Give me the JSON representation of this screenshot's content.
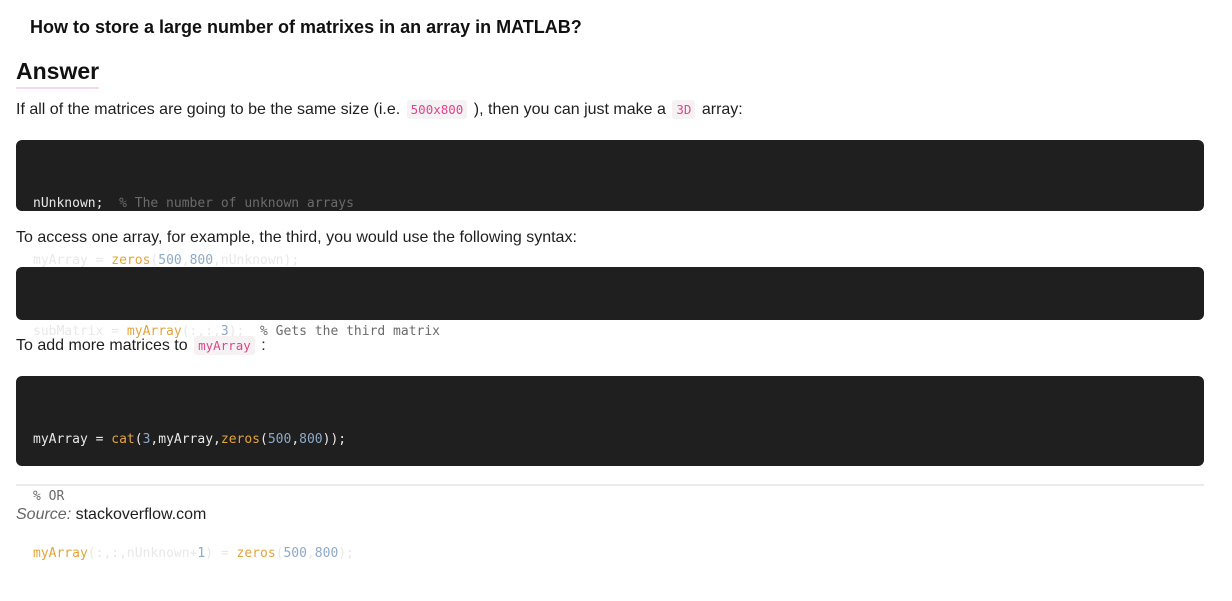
{
  "question": "How to store a large number of matrixes in an array in MATLAB?",
  "answer_heading": "Answer",
  "para1": {
    "t1": "If all of the matrices are going to be the same size (i.e. ",
    "code1": "500x800",
    "t2": " ), then you can just make a ",
    "code2": "3D",
    "t3": " array:"
  },
  "code1": {
    "l1": {
      "a": "nUnknown;  ",
      "b": "% The number of unknown arrays"
    },
    "l2": {
      "a": "myArray = ",
      "f": "zeros",
      "p1": "(",
      "n1": "500",
      "c1": ",",
      "n2": "800",
      "r": ",nUnknown);"
    }
  },
  "para2": "To access one array, for example, the third, you would use the following syntax:",
  "code2": {
    "l1": {
      "a": "subMatrix = ",
      "f": "myArray",
      "p": "(:,:,",
      "n": "3",
      "r": ");  ",
      "c": "% Gets the third matrix"
    }
  },
  "para3": {
    "t1": "To add more matrices to ",
    "code": "myArray",
    "t2": " :"
  },
  "code3": {
    "l1": {
      "a": "myArray = ",
      "f1": "cat",
      "p1": "(",
      "n1": "3",
      "m": ",myArray,",
      "f2": "zeros",
      "p2": "(",
      "n2": "500",
      "c": ",",
      "n3": "800",
      "r": "));"
    },
    "l2": {
      "c": "% OR"
    },
    "l3": {
      "f1": "myArray",
      "m": "(:,:,nUnknown+",
      "n1": "1",
      "r1": ") = ",
      "f2": "zeros",
      "p": "(",
      "n2": "500",
      "c": ",",
      "n3": "800",
      "r2": ");"
    }
  },
  "source": {
    "label": "Source:",
    "domain": "stackoverflow.com"
  }
}
